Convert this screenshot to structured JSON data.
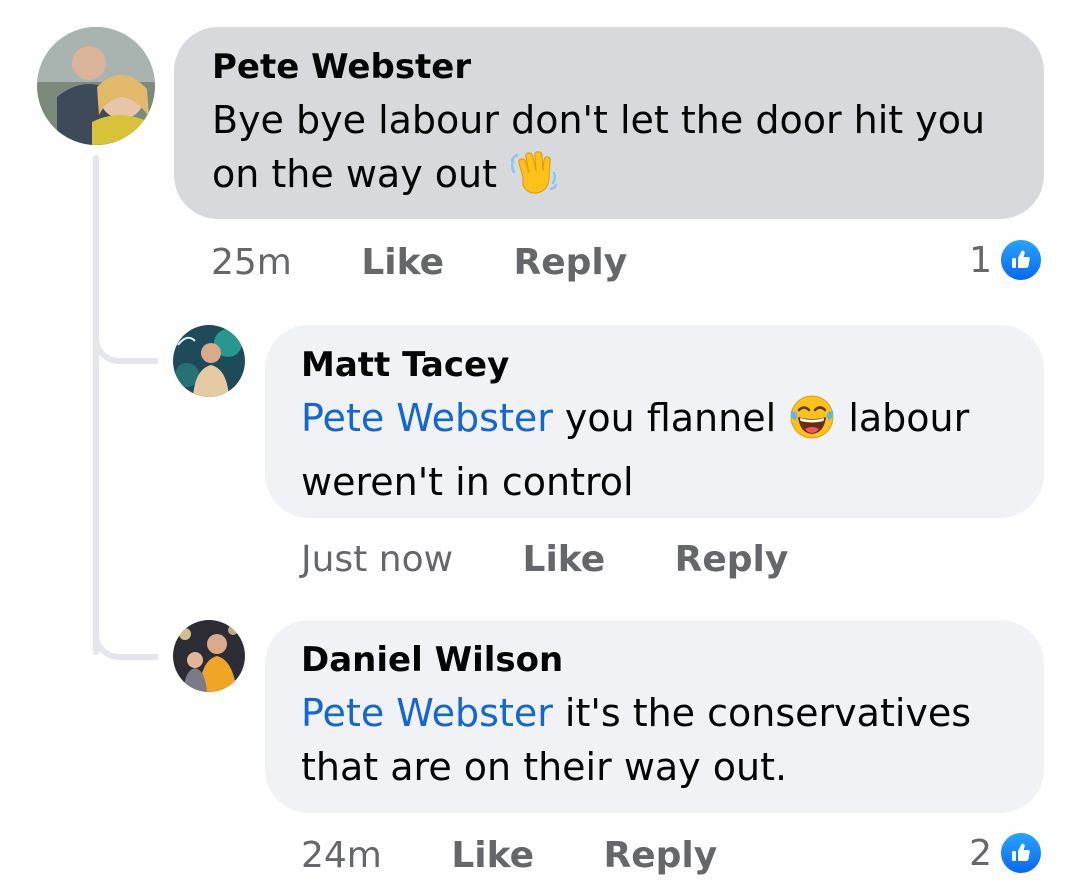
{
  "comments": [
    {
      "author": "Pete Webster",
      "text_line1": "Bye bye labour don't let the door hit you",
      "text_line2": "on the way out",
      "emoji_icon": "waving-hand-icon",
      "time": "25m",
      "like_label": "Like",
      "reply_label": "Reply",
      "reaction_count": "1"
    },
    {
      "author": "Matt Tacey",
      "mention": "Pete Webster",
      "text_part1": " you flannel ",
      "emoji_icon": "tears-of-joy-icon",
      "text_part2": " labour",
      "text_line2": "weren't in control",
      "time": "Just now",
      "like_label": "Like",
      "reply_label": "Reply"
    },
    {
      "author": "Daniel Wilson",
      "mention": "Pete Webster",
      "text_part1": " it's the conservatives",
      "text_line2": "that are on their way out.",
      "time": "24m",
      "like_label": "Like",
      "reply_label": "Reply",
      "reaction_count": "2"
    }
  ],
  "colors": {
    "mention": "#1466d2",
    "bubble_main": "#d7d9dd",
    "bubble_reply": "#f0f2f5",
    "meta_text": "#65676b",
    "like_blue": "#0868f0"
  }
}
